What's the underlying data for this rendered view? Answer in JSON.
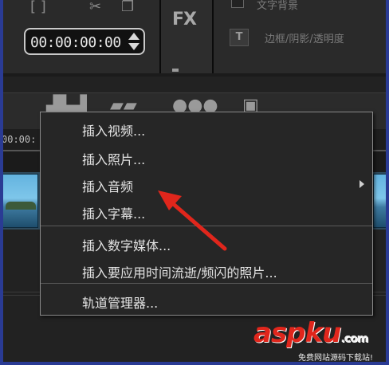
{
  "top": {
    "timecode": "00:00:00:00",
    "fx_label": "FX",
    "option_1": "文字背景",
    "option_2": "边框/阴影/透明度",
    "option_2_icon_letter": "T"
  },
  "timeline": {
    "ruler_time": "00:00:"
  },
  "context_menu": {
    "items": [
      {
        "label": "插入视频..."
      },
      {
        "label": "插入照片..."
      },
      {
        "label": "插入音频",
        "has_submenu": true
      },
      {
        "label": "插入字幕..."
      },
      {
        "label": "插入数字媒体..."
      },
      {
        "label": "插入要应用时间流逝/频闪的照片..."
      },
      {
        "label": "轨道管理器..."
      }
    ]
  },
  "watermark": {
    "brand": "aspku",
    "brand_suffix": ".com",
    "slogan": "免费网站源码下载站!"
  },
  "colors": {
    "annotation_arrow": "#e0261c",
    "window_border": "#2a3b94",
    "menu_border": "#8a8a8a"
  }
}
